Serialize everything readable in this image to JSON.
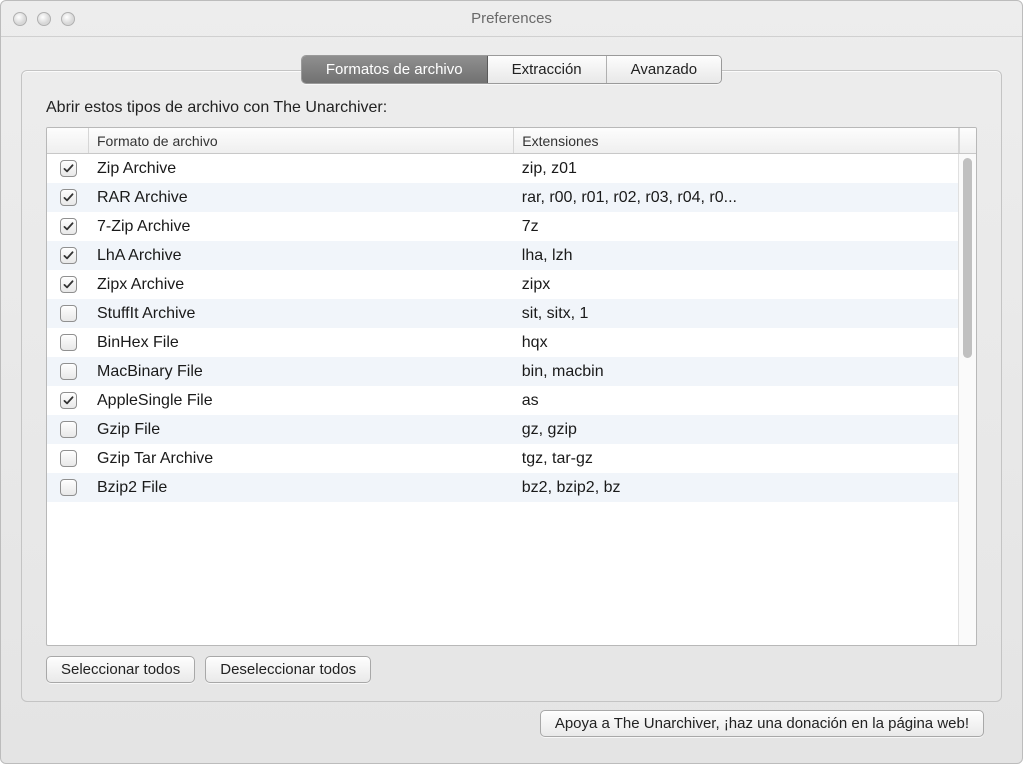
{
  "window": {
    "title": "Preferences"
  },
  "tabs": [
    {
      "label": "Formatos de archivo",
      "active": true
    },
    {
      "label": "Extracción",
      "active": false
    },
    {
      "label": "Avanzado",
      "active": false
    }
  ],
  "instruction": "Abrir estos tipos de archivo con The Unarchiver:",
  "columns": {
    "name": "Formato de archivo",
    "ext": "Extensiones"
  },
  "rows": [
    {
      "checked": true,
      "name": "Zip Archive",
      "ext": "zip, z01"
    },
    {
      "checked": true,
      "name": "RAR Archive",
      "ext": "rar, r00, r01, r02, r03, r04, r0..."
    },
    {
      "checked": true,
      "name": "7-Zip Archive",
      "ext": "7z"
    },
    {
      "checked": true,
      "name": "LhA Archive",
      "ext": "lha, lzh"
    },
    {
      "checked": true,
      "name": "Zipx Archive",
      "ext": "zipx"
    },
    {
      "checked": false,
      "name": "StuffIt Archive",
      "ext": "sit, sitx, 1"
    },
    {
      "checked": false,
      "name": "BinHex File",
      "ext": "hqx"
    },
    {
      "checked": false,
      "name": "MacBinary File",
      "ext": "bin, macbin"
    },
    {
      "checked": true,
      "name": "AppleSingle File",
      "ext": "as"
    },
    {
      "checked": false,
      "name": "Gzip File",
      "ext": "gz, gzip"
    },
    {
      "checked": false,
      "name": "Gzip Tar Archive",
      "ext": "tgz, tar-gz"
    },
    {
      "checked": false,
      "name": "Bzip2 File",
      "ext": "bz2, bzip2, bz"
    }
  ],
  "buttons": {
    "select_all": "Seleccionar todos",
    "deselect_all": "Deseleccionar todos",
    "donate": "Apoya a The Unarchiver, ¡haz una donación en la página web!"
  }
}
